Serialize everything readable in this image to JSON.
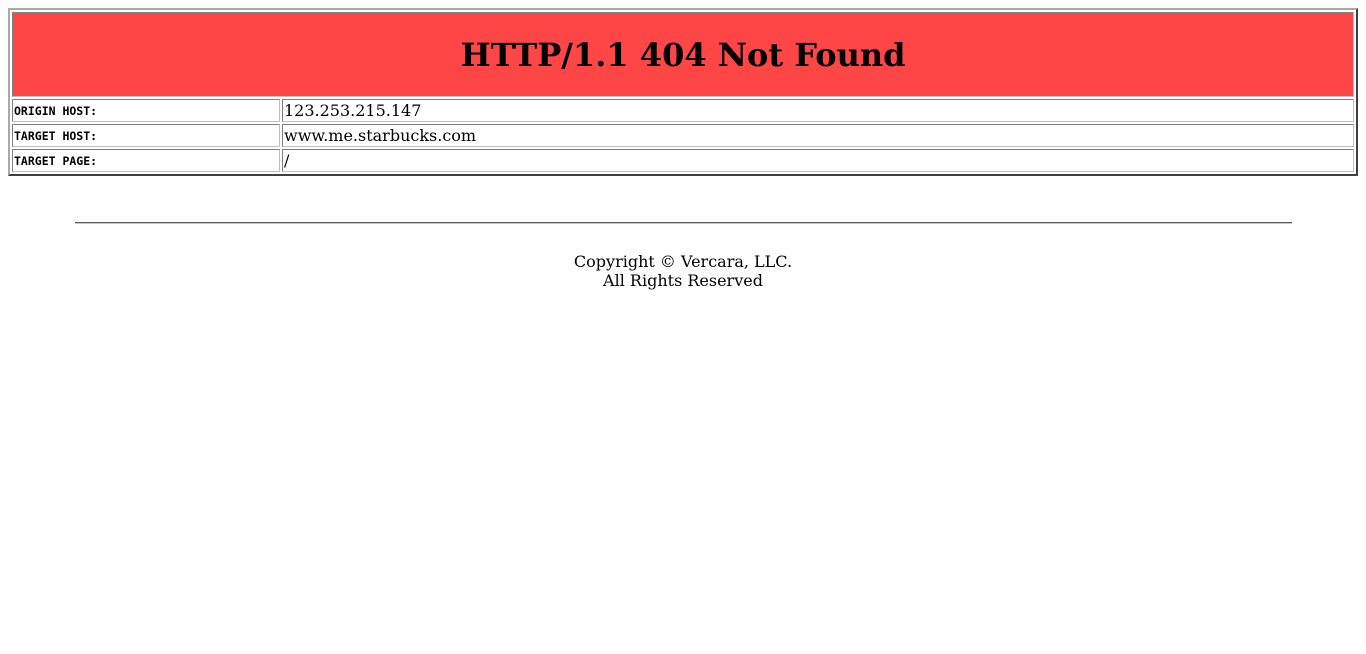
{
  "header": {
    "title": "HTTP/1.1 404 Not Found",
    "background_color": "#ff4646"
  },
  "details": [
    {
      "label": "ORIGIN HOST:",
      "value": "123.253.215.147"
    },
    {
      "label": "TARGET HOST:",
      "value": "www.me.starbucks.com"
    },
    {
      "label": "TARGET PAGE:",
      "value": "/"
    }
  ],
  "footer": {
    "copyright": "Copyright © Vercara, LLC.",
    "rights": "All Rights Reserved"
  }
}
